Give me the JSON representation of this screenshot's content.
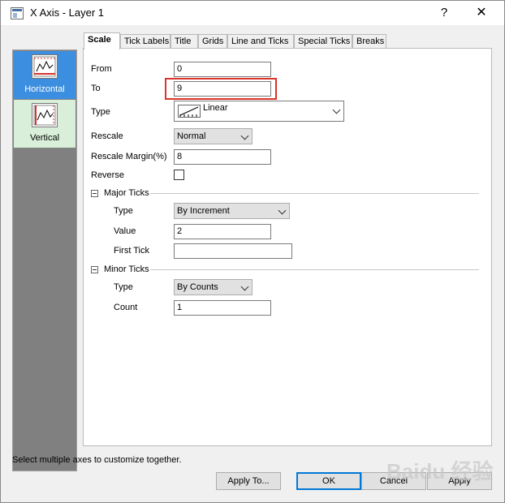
{
  "window": {
    "title": "X Axis - Layer 1",
    "help_glyph": "?",
    "close_glyph": "✕"
  },
  "sidebar": {
    "items": [
      {
        "label": "Horizontal",
        "icon": "horizontal-axis-icon",
        "selected": true
      },
      {
        "label": "Vertical",
        "icon": "vertical-axis-icon",
        "selected": false
      }
    ]
  },
  "tabs": [
    {
      "label": "Scale",
      "active": true
    },
    {
      "label": "Tick Labels"
    },
    {
      "label": "Title"
    },
    {
      "label": "Grids"
    },
    {
      "label": "Line and Ticks"
    },
    {
      "label": "Special Ticks"
    },
    {
      "label": "Breaks"
    }
  ],
  "scale": {
    "from_label": "From",
    "from_value": "0",
    "to_label": "To",
    "to_value": "9",
    "type_label": "Type",
    "type_value": "Linear",
    "rescale_label": "Rescale",
    "rescale_value": "Normal",
    "margin_label": "Rescale Margin(%)",
    "margin_value": "8",
    "reverse_label": "Reverse",
    "reverse_checked": false
  },
  "major_ticks": {
    "heading": "Major Ticks",
    "type_label": "Type",
    "type_value": "By Increment",
    "value_label": "Value",
    "value_value": "2",
    "first_tick_label": "First Tick",
    "first_tick_value": ""
  },
  "minor_ticks": {
    "heading": "Minor Ticks",
    "type_label": "Type",
    "type_value": "By Counts",
    "count_label": "Count",
    "count_value": "1"
  },
  "status_text": "Select multiple axes to customize together.",
  "buttons": {
    "apply_to": "Apply To...",
    "ok": "OK",
    "cancel": "Cancel",
    "apply": "Apply"
  },
  "watermark": "Baidu 经验",
  "colors": {
    "selected_item": "#3c8ee0",
    "unselected_item": "#d9efd9",
    "highlight": "#d9342b"
  }
}
